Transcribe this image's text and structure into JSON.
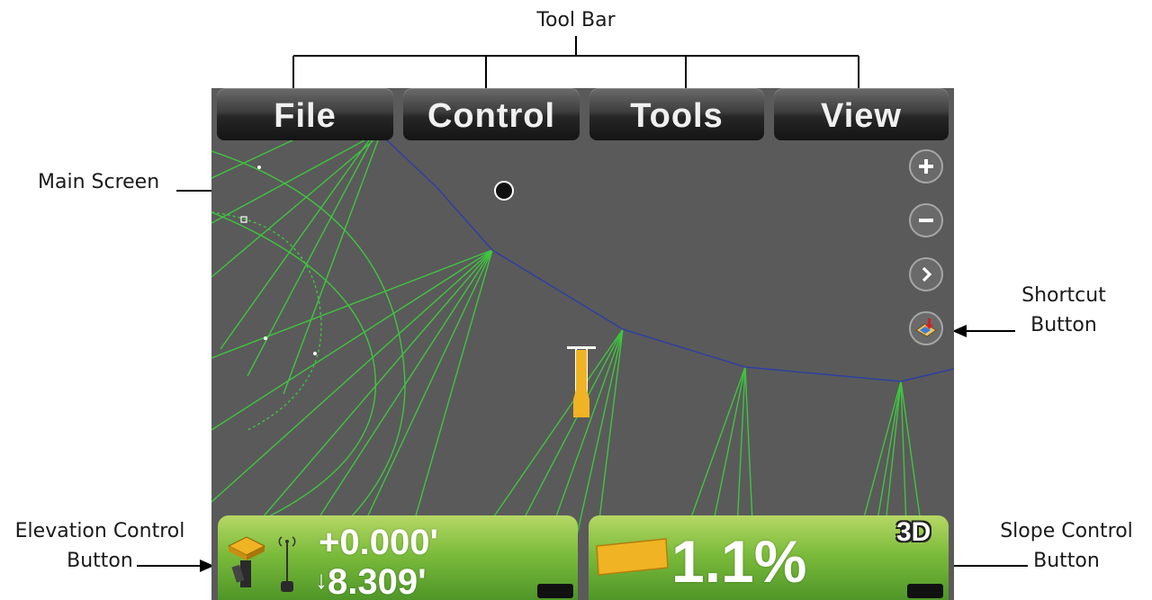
{
  "callouts": {
    "tool_bar": "Tool Bar",
    "main_screen": "Main Screen",
    "shortcut_line1": "Shortcut",
    "shortcut_line2": "Button",
    "elevation_line1": "Elevation Control",
    "elevation_line2": "Button",
    "slope_line1": "Slope Control",
    "slope_line2": "Button"
  },
  "menu": {
    "file": "File",
    "control": "Control",
    "tools": "Tools",
    "view": "View"
  },
  "side_buttons": {
    "zoom_in_icon": "plus-icon",
    "zoom_out_icon": "minus-icon",
    "next_icon": "chevron-right-icon",
    "shortcut_icon": "shortcut-map-icon"
  },
  "elevation_control": {
    "offset": "+0.000'",
    "cut_value": "8.309'",
    "cut_arrow": "↓"
  },
  "slope_control": {
    "value": "1.1%",
    "mode": "3D"
  },
  "colors": {
    "screen_bg": "#5a5a5a",
    "design_lines": "#3ecb3e",
    "alignment_line": "#2f3fa0",
    "machine": "#f0b323",
    "button_green": "#7cbc3b"
  }
}
